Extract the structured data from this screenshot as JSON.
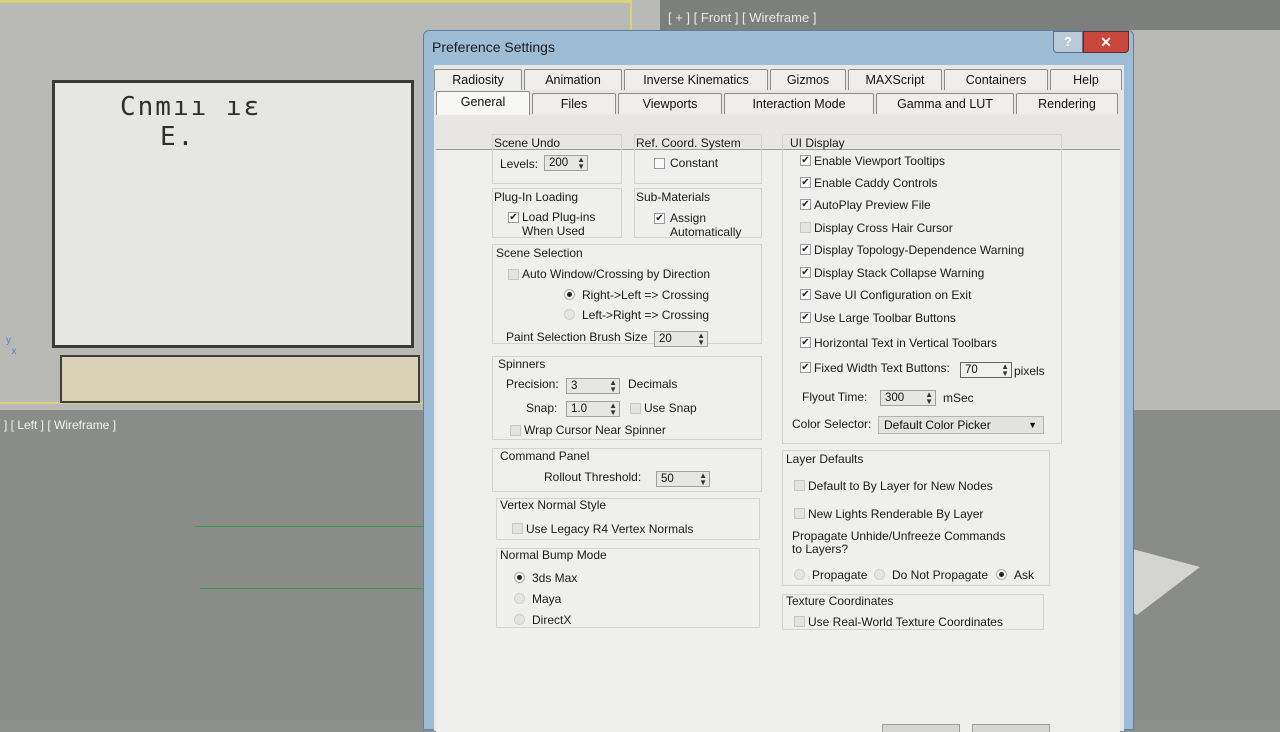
{
  "viewports": {
    "front_label": "[ + ] [ Front ] [ Wireframe ]",
    "left_label": "] [ Left ] [ Wireframe ]",
    "drawing_text_line1": "Cnmıı ıɛ",
    "drawing_text_line2": "E."
  },
  "dialog": {
    "title": "Preference Settings",
    "help": "?",
    "close": "✕"
  },
  "tabs": {
    "row1": [
      "Radiosity",
      "Animation",
      "Inverse Kinematics",
      "Gizmos",
      "MAXScript",
      "Containers",
      "Help"
    ],
    "row2": [
      "General",
      "Files",
      "Viewports",
      "Interaction Mode",
      "Gamma and LUT",
      "Rendering"
    ],
    "active": "General"
  },
  "scene_undo": {
    "title": "Scene Undo",
    "levels_label": "Levels:",
    "levels_value": "200"
  },
  "ref_coord": {
    "title": "Ref. Coord. System",
    "constant_label": "Constant",
    "constant_checked": false
  },
  "plugin": {
    "title": "Plug-In Loading",
    "load_label_1": "Load Plug-ins",
    "load_label_2": "When Used",
    "checked": true
  },
  "submaterials": {
    "title": "Sub-Materials",
    "assign_label_1": "Assign",
    "assign_label_2": "Automatically",
    "checked": true
  },
  "scene_selection": {
    "title": "Scene Selection",
    "auto_window": "Auto Window/Crossing by Direction",
    "r2l": "Right->Left => Crossing",
    "l2r": "Left->Right => Crossing",
    "brush_label": "Paint Selection Brush Size",
    "brush_value": "20"
  },
  "spinners": {
    "title": "Spinners",
    "precision_label": "Precision:",
    "precision_value": "3",
    "decimals": "Decimals",
    "snap_label": "Snap:",
    "snap_value": "1.0",
    "use_snap": "Use Snap",
    "wrap": "Wrap Cursor Near Spinner"
  },
  "command_panel": {
    "title": "Command Panel",
    "rollout_label": "Rollout Threshold:",
    "rollout_value": "50"
  },
  "vertex_normal": {
    "title": "Vertex Normal Style",
    "legacy": "Use Legacy R4 Vertex Normals"
  },
  "normal_bump": {
    "title": "Normal Bump Mode",
    "options": [
      "3ds Max",
      "Maya",
      "DirectX"
    ],
    "selected": "3ds Max"
  },
  "ui_display": {
    "title": "UI Display",
    "items": [
      {
        "label": "Enable Viewport Tooltips",
        "checked": true
      },
      {
        "label": "Enable Caddy Controls",
        "checked": true
      },
      {
        "label": "AutoPlay Preview File",
        "checked": true
      },
      {
        "label": "Display Cross Hair Cursor",
        "checked": false
      },
      {
        "label": "Display Topology-Dependence Warning",
        "checked": true
      },
      {
        "label": "Display Stack Collapse Warning",
        "checked": true
      },
      {
        "label": "Save UI Configuration on Exit",
        "checked": true
      },
      {
        "label": "Use Large Toolbar Buttons",
        "checked": true
      },
      {
        "label": "Horizontal Text in Vertical Toolbars",
        "checked": true
      },
      {
        "label": "Fixed Width Text Buttons:",
        "checked": true
      }
    ],
    "fixed_width_value": "70",
    "pixels": "pixels",
    "flyout_label": "Flyout Time:",
    "flyout_value": "300",
    "msec": "mSec",
    "color_selector_label": "Color Selector:",
    "color_selector_value": "Default Color Picker"
  },
  "layer_defaults": {
    "title": "Layer Defaults",
    "default_by_layer": "Default to By Layer for New Nodes",
    "new_lights": "New Lights Renderable By Layer",
    "propagate_title_1": "Propagate Unhide/Unfreeze Commands",
    "propagate_title_2": "to Layers?",
    "propagate": "Propagate",
    "do_not_propagate": "Do Not Propagate",
    "ask": "Ask",
    "selected": "Ask"
  },
  "texture_coords": {
    "title": "Texture Coordinates",
    "real_world": "Use Real-World Texture Coordinates"
  }
}
